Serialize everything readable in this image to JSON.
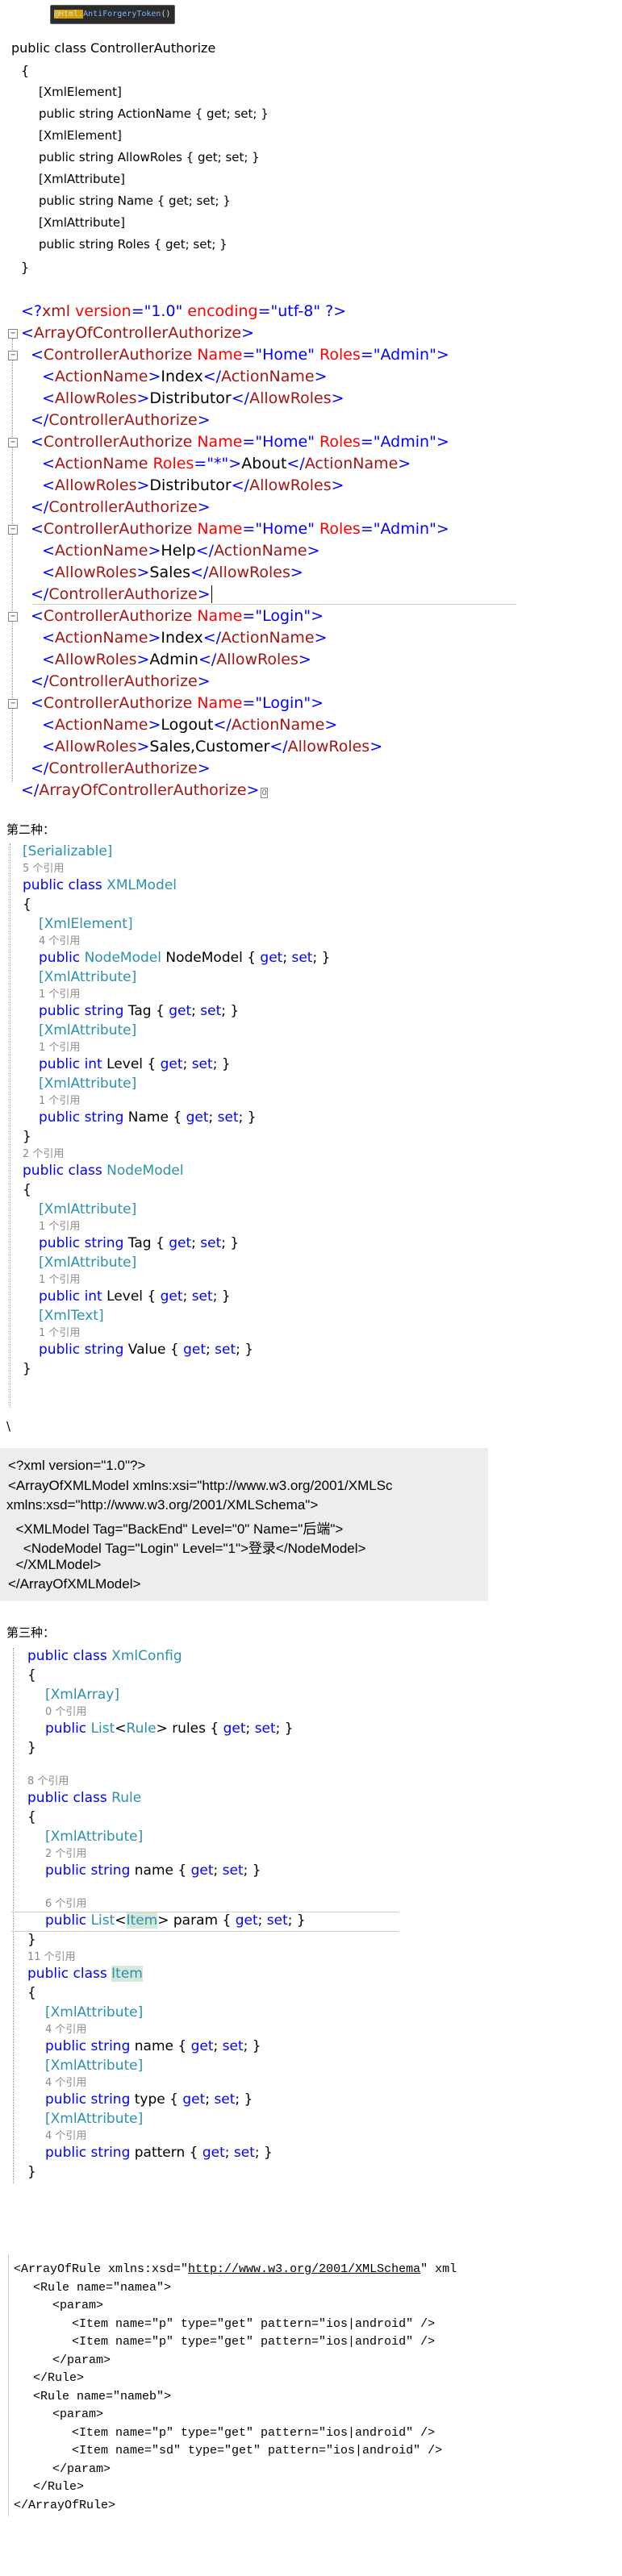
{
  "badge": {
    "prefix": "@Html.",
    "method": "AntiForgeryToken",
    "suffix": "()"
  },
  "block1": {
    "class_decl": "public class ControllerAuthorize",
    "open": "{",
    "lines": [
      "[XmlElement]",
      "public string ActionName { get; set; }",
      "[XmlElement]",
      "public string AllowRoles { get; set; }",
      "[XmlAttribute]",
      "public string Name { get; set; }",
      "[XmlAttribute]",
      "public string Roles { get; set; }"
    ],
    "close": "}"
  },
  "xml1": {
    "decl": "<?xml version=\"1.0\" encoding=\"utf-8\" ?>",
    "root_open": "<ArrayOfControllerAuthorize>",
    "root_close": "</ArrayOfControllerAuthorize>",
    "entries": [
      {
        "open_name": "Home",
        "open_roles": "Admin",
        "action": "Index",
        "action_roles": null,
        "allow": "Distributor"
      },
      {
        "open_name": "Home",
        "open_roles": "Admin",
        "action": "About",
        "action_roles": "*",
        "allow": "Distributor"
      },
      {
        "open_name": "Home",
        "open_roles": "Admin",
        "action": "Help",
        "action_roles": null,
        "allow": "Sales"
      },
      {
        "open_name": "Login",
        "open_roles": null,
        "action": "Index",
        "action_roles": null,
        "allow": "Admin"
      },
      {
        "open_name": "Login",
        "open_roles": null,
        "action": "Logout",
        "action_roles": null,
        "allow": "Sales,Customer"
      }
    ],
    "tag_ca": "ControllerAuthorize",
    "attr_name": "Name",
    "attr_roles": "Roles",
    "tag_action": "ActionName",
    "tag_allow": "AllowRoles"
  },
  "section2": {
    "title": "第二种：",
    "code": [
      {
        "t": "attr",
        "text": "Serializable"
      },
      {
        "t": "ref",
        "text": "5 个引用"
      },
      {
        "t": "class",
        "text": "XMLModel"
      },
      {
        "t": "brace",
        "text": "{"
      },
      {
        "t": "attr",
        "text": "XmlElement"
      },
      {
        "t": "ref",
        "text": "4 个引用"
      },
      {
        "t": "prop",
        "type": "NodeModel",
        "name": "NodeModel"
      },
      {
        "t": "attr",
        "text": "XmlAttribute"
      },
      {
        "t": "ref",
        "text": "1 个引用"
      },
      {
        "t": "prop",
        "type": "string",
        "name": "Tag"
      },
      {
        "t": "attr",
        "text": "XmlAttribute"
      },
      {
        "t": "ref",
        "text": "1 个引用"
      },
      {
        "t": "prop",
        "type": "int",
        "name": "Level"
      },
      {
        "t": "attr",
        "text": "XmlAttribute"
      },
      {
        "t": "ref",
        "text": "1 个引用"
      },
      {
        "t": "prop",
        "type": "string",
        "name": "Name"
      },
      {
        "t": "brace",
        "text": "}"
      },
      {
        "t": "ref",
        "text": "2 个引用"
      },
      {
        "t": "class",
        "text": "NodeModel"
      },
      {
        "t": "brace",
        "text": "{"
      },
      {
        "t": "attr",
        "text": "XmlAttribute"
      },
      {
        "t": "ref",
        "text": "1 个引用"
      },
      {
        "t": "prop",
        "type": "string",
        "name": "Tag"
      },
      {
        "t": "attr",
        "text": "XmlAttribute"
      },
      {
        "t": "ref",
        "text": "1 个引用"
      },
      {
        "t": "prop",
        "type": "int",
        "name": "Level"
      },
      {
        "t": "attr",
        "text": "XmlText"
      },
      {
        "t": "ref",
        "text": "1 个引用"
      },
      {
        "t": "prop",
        "type": "string",
        "name": "Value"
      },
      {
        "t": "brace",
        "text": "}"
      }
    ],
    "trailing": "\\",
    "xml": [
      "<?xml version=\"1.0\"?>",
      "<ArrayOfXMLModel xmlns:xsi=\"http://www.w3.org/2001/XMLSc",
      "xmlns:xsd=\"http://www.w3.org/2001/XMLSchema\">",
      "  <XMLModel Tag=\"BackEnd\" Level=\"0\" Name=\"后端\">",
      "    <NodeModel Tag=\"Login\" Level=\"1\">登录</NodeModel>",
      "  </XMLModel>",
      "</ArrayOfXMLModel>"
    ]
  },
  "section3": {
    "title": "第三种：",
    "xmlconfig": {
      "class": "XmlConfig",
      "attr": "XmlArray",
      "ref": "0 个引用",
      "list_type": "Rule",
      "prop": "rules"
    },
    "rule": {
      "ref_class": "8 个引用",
      "class": "Rule",
      "attr": "XmlAttribute",
      "ref1": "2 个引用",
      "prop1": "name",
      "ref2": "6 个引用",
      "list_type": "Item",
      "prop2": "param"
    },
    "item": {
      "ref_class": "11 个引用",
      "class": "Item",
      "fields": [
        {
          "ref": "4 个引用",
          "name": "name"
        },
        {
          "ref": "4 个引用",
          "name": "type"
        },
        {
          "ref": "4 个引用",
          "name": "pattern"
        }
      ]
    },
    "common": {
      "public": "public",
      "string": "string",
      "class": "class",
      "getset": "{ get; set; }",
      "list": "List"
    },
    "xml": [
      {
        "indent": 0,
        "text": "<ArrayOfRule xmlns:xsd=\"",
        "link": "http://www.w3.org/2001/XMLSchema",
        "after": "\" xml"
      },
      {
        "indent": 1,
        "text": "<Rule name=\"namea\">"
      },
      {
        "indent": 2,
        "text": "<param>"
      },
      {
        "indent": 3,
        "text": "<Item name=\"p\" type=\"get\" pattern=\"ios|android\" />"
      },
      {
        "indent": 3,
        "text": "<Item name=\"p\" type=\"get\" pattern=\"ios|android\" />"
      },
      {
        "indent": 2,
        "text": "</param>"
      },
      {
        "indent": 1,
        "text": "</Rule>"
      },
      {
        "indent": 1,
        "text": "<Rule name=\"nameb\">"
      },
      {
        "indent": 2,
        "text": "<param>"
      },
      {
        "indent": 3,
        "text": "<Item name=\"p\" type=\"get\" pattern=\"ios|android\" />"
      },
      {
        "indent": 3,
        "text": "<Item name=\"sd\" type=\"get\" pattern=\"ios|android\" />"
      },
      {
        "indent": 2,
        "text": "</param>"
      },
      {
        "indent": 1,
        "text": "</Rule>"
      },
      {
        "indent": 0,
        "text": "</ArrayOfRule>"
      }
    ]
  }
}
